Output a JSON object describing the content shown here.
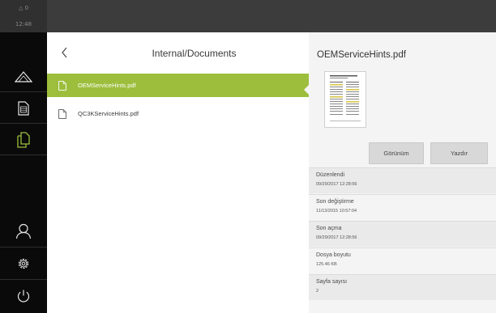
{
  "status": {
    "warning_count": "0",
    "time": "12:48"
  },
  "sidebar": {
    "items": [
      {
        "icon": "measure-triangle-icon"
      },
      {
        "icon": "document-icon"
      },
      {
        "icon": "file-manager-icon",
        "active": true
      },
      {
        "icon": "user-icon"
      },
      {
        "icon": "settings-gear-icon"
      },
      {
        "icon": "power-icon"
      }
    ],
    "active_color": "#9cbe3c"
  },
  "list": {
    "title": "Internal/Documents",
    "files": [
      {
        "name": "OEMServiceHints.pdf",
        "selected": true
      },
      {
        "name": "QC3KServiceHints.pdf",
        "selected": false
      }
    ],
    "selected_color": "#9cbe3c"
  },
  "detail": {
    "title": "OEMServiceHints.pdf",
    "view_button": "Görünüm",
    "print_button": "Yazdır",
    "info": [
      {
        "label": "Düzenlendi",
        "value": "09/29/2017 12:28:56"
      },
      {
        "label": "Son değiştirme",
        "value": "11/13/2015 10:57:04"
      },
      {
        "label": "Son açma",
        "value": "09/29/2017 12:28:56"
      },
      {
        "label": "Dosya boyutu",
        "value": "125.46 KB"
      },
      {
        "label": "Sayfa sayısı",
        "value": "2"
      }
    ]
  }
}
